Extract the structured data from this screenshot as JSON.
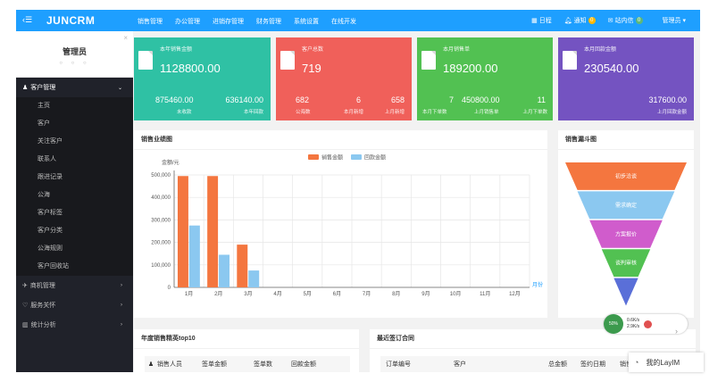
{
  "topbar": {
    "logo": "JUNCRM",
    "nav": [
      "销售管理",
      "办公管理",
      "进销存管理",
      "财务管理",
      "系统设置",
      "在线开发"
    ],
    "calendar": "日程",
    "notice": "通知",
    "notice_count": "0",
    "message": "站内信",
    "message_count": "0",
    "user": "管理员 ▾"
  },
  "sidebar": {
    "profile_name": "管理员",
    "profile_dots": "○ ○ ○",
    "groups": [
      {
        "label": "客户管理",
        "expanded": true
      },
      {
        "label": "商机管理"
      },
      {
        "label": "服务关怀"
      },
      {
        "label": "统计分析"
      }
    ],
    "items": [
      "主页",
      "客户",
      "关注客户",
      "联系人",
      "跟进记录",
      "公海",
      "客户标签",
      "客户分类",
      "公海规则",
      "客户回收站"
    ]
  },
  "cards": [
    {
      "title": "本年销售金额",
      "big": "1128800.00",
      "v1": "875460.00",
      "l1": "未收款",
      "v2": "636140.00",
      "l2": "本年回款",
      "color": "#2fc1a4"
    },
    {
      "title": "客户总数",
      "big": "719",
      "v1": "682",
      "l1": "公海数",
      "v2": "6",
      "l2": "本月新增",
      "v3": "658",
      "l3": "上月新增",
      "color": "#f0605a"
    },
    {
      "title": "本月销售单",
      "big": "189200.00",
      "v1": "7",
      "l1": "本月下单数",
      "v2": "450800.00",
      "l2": "上月销售单",
      "v3": "11",
      "l3": "上月下单数",
      "color": "#52c152"
    },
    {
      "title": "本月回款金额",
      "big": "230540.00",
      "v1": "317600.00",
      "l1": "上月回款金额",
      "color": "#7453c1"
    }
  ],
  "sales_panel": {
    "title": "销售业绩图"
  },
  "funnel_panel": {
    "title": "销售漏斗图"
  },
  "top10_panel": {
    "title": "年度销售精英top10",
    "headers": [
      "销售人员",
      "签单金额",
      "签单数",
      "回款金额"
    ]
  },
  "contracts_panel": {
    "title": "最近签订合同",
    "headers": [
      "订单编号",
      "客户",
      "总金额",
      "签约日期",
      "销售"
    ]
  },
  "floating": {
    "network_up": "0.6K/s",
    "network_down": "2.9K/s",
    "chat": "我的LayIM",
    "speed": "50%"
  },
  "chart_data": [
    {
      "type": "bar",
      "title": "",
      "ylabel": "金额/元",
      "xlabel": "月份",
      "categories": [
        "1月",
        "2月",
        "3月",
        "4月",
        "5月",
        "6月",
        "7月",
        "8月",
        "9月",
        "10月",
        "11月",
        "12月"
      ],
      "ylim": [
        0,
        500000
      ],
      "yticks": [
        "0",
        "100,000",
        "200,000",
        "300,000",
        "400,000",
        "500,000"
      ],
      "legend_position": "top",
      "series": [
        {
          "name": "销售金额",
          "color": "#f4763f",
          "values": [
            495000,
            495000,
            190000,
            0,
            0,
            0,
            0,
            0,
            0,
            0,
            0,
            0
          ]
        },
        {
          "name": "回款金额",
          "color": "#8bc8f0",
          "values": [
            275000,
            145000,
            75000,
            0,
            0,
            0,
            0,
            0,
            0,
            0,
            0,
            0
          ]
        }
      ]
    },
    {
      "type": "funnel",
      "stages": [
        {
          "label": "初步洽谈",
          "color": "#f4763f"
        },
        {
          "label": "需求确定",
          "color": "#8bc8f0"
        },
        {
          "label": "方案报价",
          "color": "#d05ccc"
        },
        {
          "label": "谈判审核",
          "color": "#52c152"
        },
        {
          "label": "",
          "color": "#5a6fd8"
        }
      ]
    }
  ]
}
